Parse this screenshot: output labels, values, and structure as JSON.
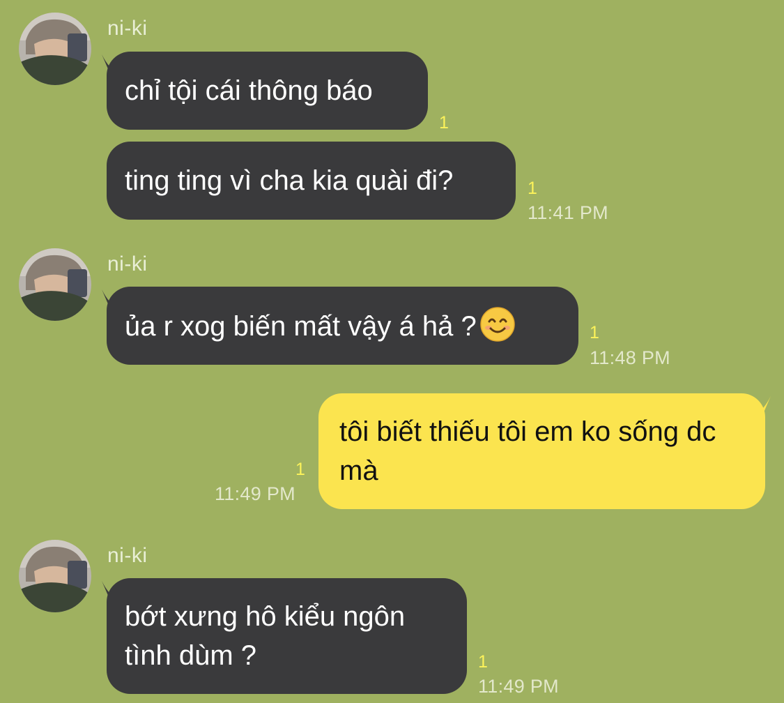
{
  "chat": {
    "messages": [
      {
        "sender": "ni-ki",
        "bubbles": [
          {
            "text": "chỉ tội cái thông báo",
            "unread": "1"
          },
          {
            "text": "ting ting vì cha kia quài đi?",
            "unread": "1",
            "time": "11:41 PM"
          }
        ]
      },
      {
        "sender": "ni-ki",
        "bubbles": [
          {
            "text": "ủa r xog biến mất vậy á hả ?",
            "emoji": "smiling-face-icon",
            "unread": "1",
            "time": "11:48 PM"
          }
        ]
      },
      {
        "sender": "me",
        "bubbles": [
          {
            "text": "tôi biết thiếu tôi em ko sống dc mà",
            "unread": "1",
            "time": "11:49 PM"
          }
        ]
      },
      {
        "sender": "ni-ki",
        "bubbles": [
          {
            "text": "bớt xưng hô kiểu ngôn tình dùm ?",
            "unread": "1",
            "time": "11:49 PM"
          }
        ]
      }
    ]
  },
  "colors": {
    "background": "#9fb160",
    "incoming_bubble": "#3a3a3c",
    "outgoing_bubble": "#fbe44f",
    "unread_count": "#fcf35a"
  }
}
